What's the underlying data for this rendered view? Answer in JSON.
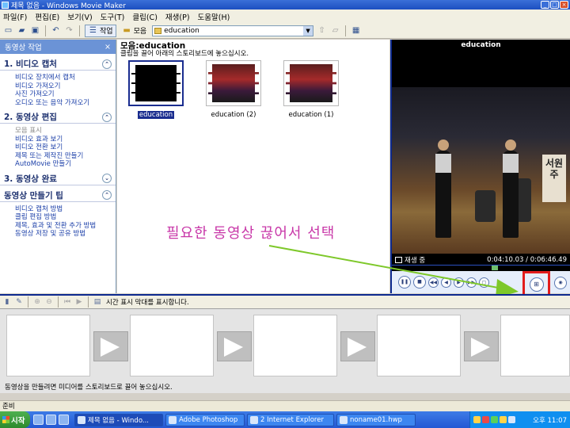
{
  "window": {
    "title": "제목 없음 - Windows Movie Maker"
  },
  "menu": [
    "파일(F)",
    "편집(E)",
    "보기(V)",
    "도구(T)",
    "클립(C)",
    "재생(P)",
    "도움말(H)"
  ],
  "toolbar": {
    "tasks_label": "작업",
    "collections_label": "모음",
    "collection_value": "education"
  },
  "taskpane": {
    "header": "동영상 작업",
    "close_glyph": "×",
    "sections": [
      {
        "title": "1. 비디오 캡처",
        "toggle": "⌃",
        "links": [
          "비디오 장치에서 캡처",
          "비디오 가져오기",
          "사진 가져오기",
          "오디오 또는 음악 가져오기"
        ]
      },
      {
        "title": "2. 동영상 편집",
        "toggle": "⌃",
        "links": [
          "모음 표시",
          "비디오 효과 보기",
          "비디오 전환 보기",
          "제목 또는 제작진 만들기",
          "AutoMovie 만들기"
        ]
      },
      {
        "title": "3. 동영상 완료",
        "toggle": "⌄",
        "links": []
      },
      {
        "title": "동영상 만들기 팁",
        "toggle": "⌃",
        "links": [
          "비디오 캡처 방법",
          "클립 편집 방법",
          "제목, 효과 및 전환 추가 방법",
          "동영상 저장 및 공유 방법"
        ]
      }
    ]
  },
  "collection": {
    "title": "모음:education",
    "hint": "클립을 끌어 아래의 스토리보드에 놓으십시오.",
    "clips": [
      "education",
      "education (2)",
      "education (1)"
    ]
  },
  "monitor": {
    "title": "education",
    "status": "재생 중",
    "time": "0:04:10.03 / 0:06:46.49",
    "banner_text": "서원주",
    "seek_progress": 0.58
  },
  "annotation": {
    "text": "필요한 동영상 끊어서 선택",
    "color": "#c837a8",
    "arrow_color": "#7ec82a",
    "highlight_color": "#e21c1c"
  },
  "storyboard": {
    "timeline_label": "시간 표시 막대를 표시합니다.",
    "hint": "동영상을 만들려면 미디어를 스토리보드로 끌어 놓으십시오.",
    "frames": 5
  },
  "statusbar": {
    "text": "준비"
  },
  "taskbar": {
    "start": "시작",
    "tasks": [
      "제목 없음 - Windo...",
      "Adobe Photoshop",
      "2 Internet Explorer",
      "noname01.hwp"
    ],
    "clock": "오후 11:07"
  }
}
